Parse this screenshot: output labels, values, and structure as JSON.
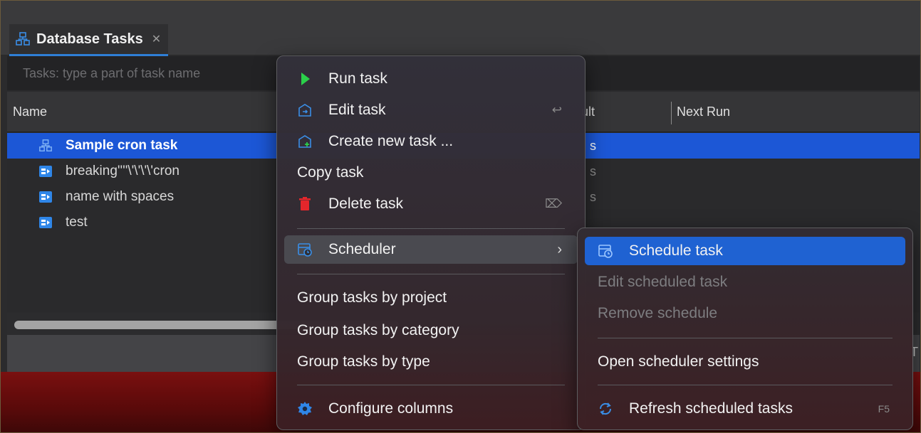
{
  "tab": {
    "title": "Database Tasks",
    "close_glyph": "✕"
  },
  "filter": {
    "placeholder": "Tasks: type a part of task name",
    "value": ""
  },
  "table": {
    "columns": {
      "name": "Name",
      "result_fragment": "ult",
      "next_run": "Next Run"
    },
    "rows": [
      {
        "label": "Sample cron task",
        "result": "s",
        "selected": true,
        "icon": "task-group-icon"
      },
      {
        "label": "breaking''''\\'\\'\\'\\'cron",
        "result": "s",
        "selected": false,
        "icon": "task-icon"
      },
      {
        "label": "name with spaces",
        "result": "s",
        "selected": false,
        "icon": "task-icon"
      },
      {
        "label": "test",
        "result": "",
        "selected": false,
        "icon": "task-icon"
      }
    ]
  },
  "status": {
    "fragment": "T"
  },
  "context_menu": {
    "run_task": "Run task",
    "edit_task": "Edit task",
    "edit_shortcut": "↩",
    "create_new_task": "Create new task ...",
    "copy_task": "Copy task",
    "delete_task": "Delete task",
    "delete_shortcut": "⌦",
    "scheduler": "Scheduler",
    "group_by_project": "Group tasks by project",
    "group_by_category": "Group tasks by category",
    "group_by_type": "Group tasks by type",
    "configure_columns": "Configure columns"
  },
  "scheduler_menu": {
    "schedule_task": "Schedule task",
    "edit_scheduled": "Edit scheduled task",
    "remove_schedule": "Remove schedule",
    "open_settings": "Open scheduler settings",
    "refresh": "Refresh scheduled tasks",
    "refresh_shortcut": "F5"
  },
  "colors": {
    "accent": "#1f62d2",
    "selected_row": "#1c57d6",
    "run_green": "#2bd04a",
    "delete_red": "#e3262b",
    "icon_blue": "#3a8ee6"
  }
}
